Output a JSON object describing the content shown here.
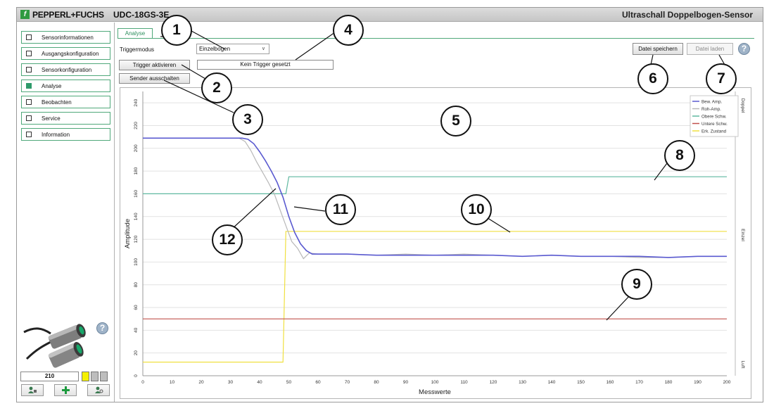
{
  "header": {
    "brand": "PEPPERL+FUCHS",
    "logo_letter": "f",
    "device": "UDC-18GS-3E",
    "title": "Ultraschall Doppelbogen-Sensor"
  },
  "sidebar": {
    "items": [
      {
        "label": "Sensorinformationen",
        "active": false
      },
      {
        "label": "Ausgangskonfiguration",
        "active": false
      },
      {
        "label": "Sensorkonfiguration",
        "active": false
      },
      {
        "label": "Analyse",
        "active": true
      },
      {
        "label": "Beobachten",
        "active": false
      },
      {
        "label": "Service",
        "active": false
      },
      {
        "label": "Information",
        "active": false
      }
    ],
    "value": "210",
    "help": "?",
    "indicator_colors": [
      "#f4f000",
      "#bdbdbd",
      "#bdbdbd"
    ]
  },
  "main": {
    "tab": "Analyse",
    "trigger_label": "Triggermodus",
    "trigger_value": "Einzelbogen",
    "trigger_button": "Trigger aktivieren",
    "sender_button": "Sender ausschalten",
    "trigger_status": "Kein Trigger gesetzt",
    "save_button": "Datei speichern",
    "load_button": "Datei laden",
    "help": "?"
  },
  "callouts": [
    "1",
    "2",
    "3",
    "4",
    "5",
    "6",
    "7",
    "8",
    "9",
    "10",
    "11",
    "12"
  ],
  "colors": {
    "accent": "#4fa87a",
    "bew": "#5a5ad0",
    "roh": "#b8b8b8",
    "obere": "#5fb8a0",
    "untere": "#c0504d",
    "erk": "#f0e040"
  },
  "chart_data": {
    "type": "line",
    "xlabel": "Messwerte",
    "ylabel": "Amplitude",
    "xlim": [
      0,
      200
    ],
    "ylim": [
      0,
      250
    ],
    "xticks": [
      0,
      10,
      20,
      30,
      40,
      50,
      60,
      70,
      80,
      90,
      100,
      110,
      120,
      130,
      140,
      150,
      160,
      170,
      180,
      190,
      200
    ],
    "yticks": [
      0,
      20,
      40,
      60,
      80,
      100,
      120,
      140,
      160,
      180,
      200,
      220,
      240
    ],
    "grid": true,
    "legend": "top-right",
    "right_labels": [
      "Doppel",
      "Einzel",
      "Luft"
    ],
    "series": [
      {
        "name": "Bew. Amp.",
        "x": [
          0,
          10,
          20,
          30,
          34,
          36,
          38,
          40,
          42,
          44,
          46,
          48,
          50,
          52,
          54,
          56,
          58,
          60,
          70,
          80,
          90,
          100,
          110,
          120,
          130,
          140,
          150,
          160,
          170,
          180,
          190,
          200
        ],
        "y": [
          209,
          209,
          209,
          209,
          209,
          208,
          204,
          197,
          189,
          180,
          170,
          157,
          140,
          126,
          116,
          110,
          107,
          107,
          107,
          106,
          106,
          106,
          106,
          106,
          105,
          106,
          105,
          105,
          105,
          104,
          105,
          105
        ]
      },
      {
        "name": "Roh-Amp.",
        "x": [
          0,
          10,
          20,
          30,
          33,
          35,
          37,
          39,
          41,
          43,
          45,
          47,
          49,
          51,
          53,
          55,
          57,
          60,
          70,
          80,
          90,
          100,
          110,
          120,
          130,
          140,
          150,
          160,
          170,
          180,
          190,
          200
        ],
        "y": [
          209,
          209,
          209,
          209,
          209,
          206,
          198,
          188,
          179,
          170,
          160,
          146,
          132,
          118,
          112,
          103,
          108,
          107,
          107,
          106,
          107,
          106,
          107,
          106,
          105,
          106,
          105,
          105,
          104,
          104,
          105,
          105
        ]
      },
      {
        "name": "Obere Schw.",
        "x": [
          0,
          49,
          50,
          200
        ],
        "y": [
          160,
          160,
          175,
          175
        ]
      },
      {
        "name": "Untere Schw.",
        "x": [
          0,
          200
        ],
        "y": [
          50,
          50
        ]
      },
      {
        "name": "Erk. Zustand",
        "x": [
          0,
          48,
          49,
          200
        ],
        "y": [
          12,
          12,
          127,
          127
        ]
      }
    ]
  }
}
